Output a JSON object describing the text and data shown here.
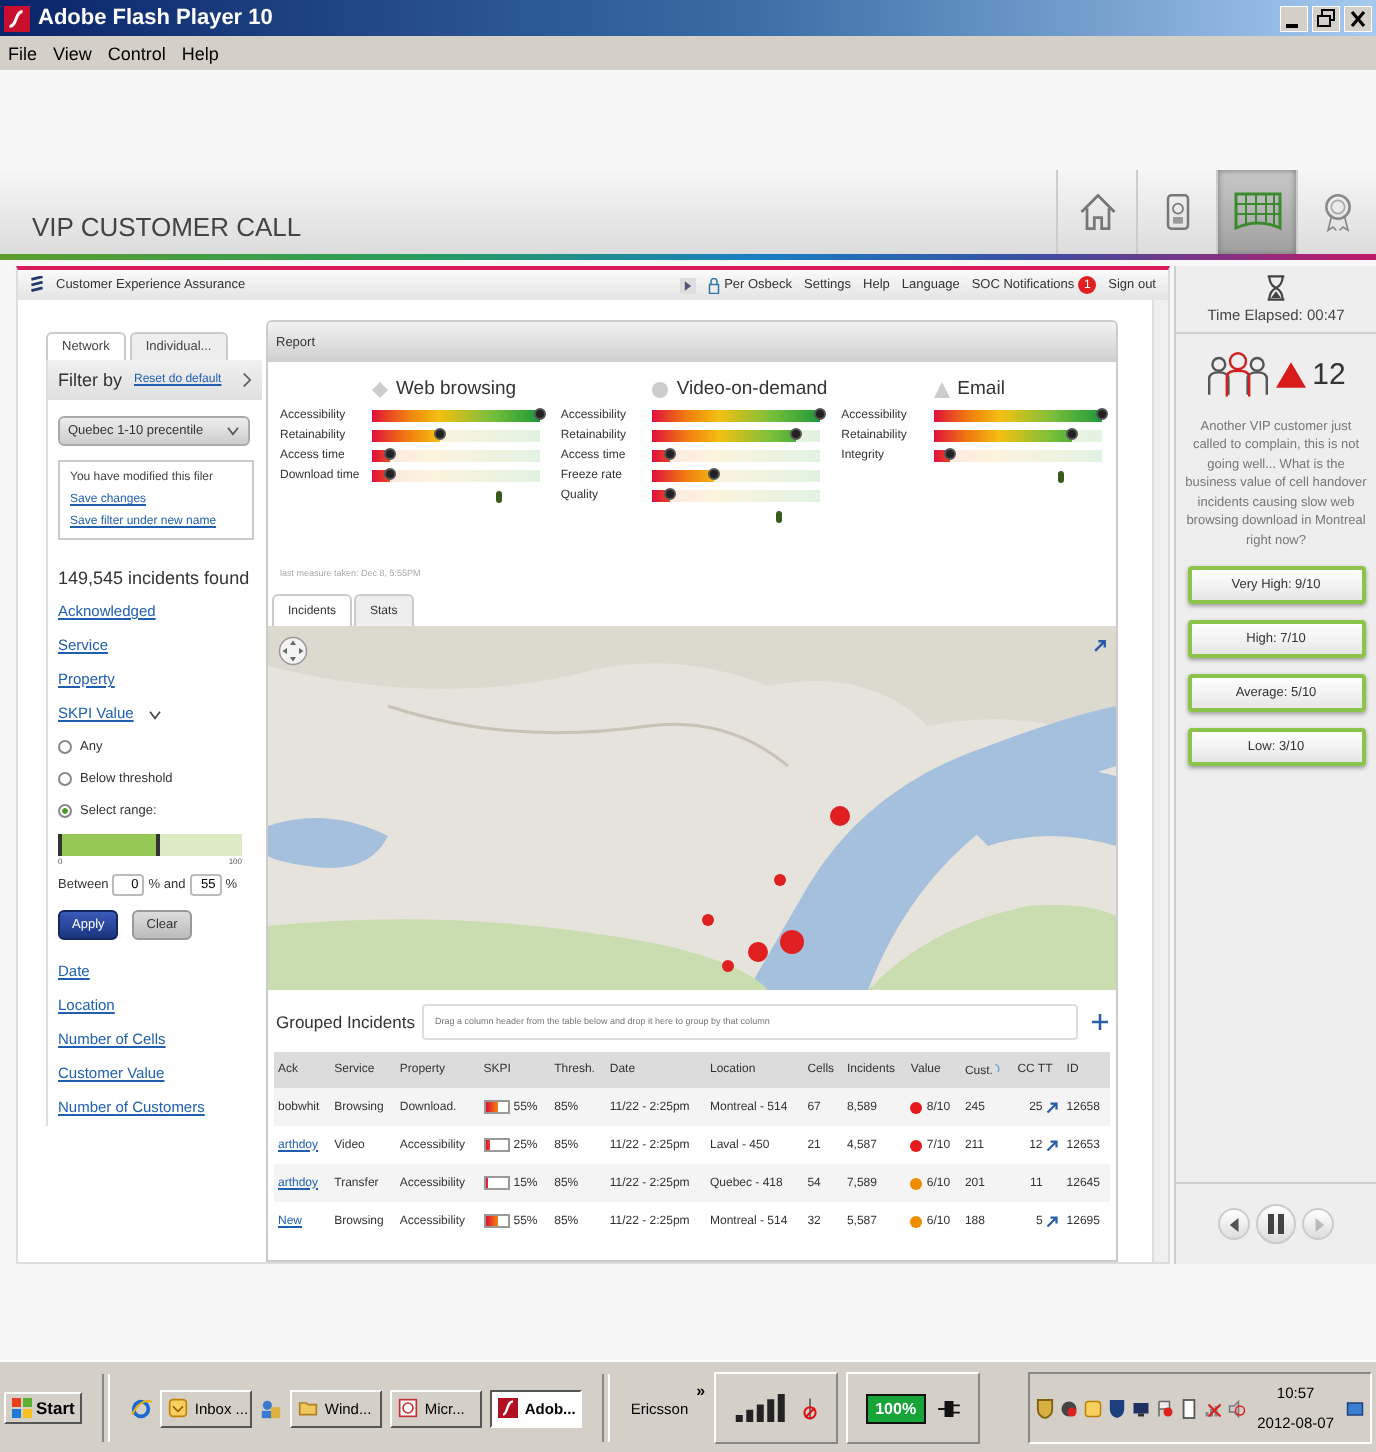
{
  "window": {
    "title": "Adobe Flash Player 10"
  },
  "menu": [
    "File",
    "View",
    "Control",
    "Help"
  ],
  "header": {
    "title": "VIP CUSTOMER CALL",
    "nav": [
      {
        "kind": "home",
        "selected": false
      },
      {
        "kind": "phone",
        "selected": false
      },
      {
        "kind": "grid",
        "selected": true
      },
      {
        "kind": "award",
        "selected": false
      }
    ]
  },
  "app_bar": {
    "title": "Customer Experience Assurance",
    "user": "Per Osbeck",
    "links": [
      "Settings",
      "Help",
      "Language"
    ],
    "notifications": {
      "label": "SOC Notifications",
      "count": "1"
    },
    "sign_out": "Sign out"
  },
  "filter": {
    "tabs": [
      {
        "label": "Network",
        "selected": true
      },
      {
        "label": "Individual...",
        "selected": false
      }
    ],
    "title": "Filter by",
    "reset": "Reset do default",
    "preset": "Quebec 1-10 precentile",
    "notice": {
      "text": "You have modified this filer",
      "links": [
        "Save changes",
        "Save filter under new name"
      ]
    },
    "count": "149,545 incidents found",
    "links_top": [
      "Acknowledged",
      "Service",
      "Property"
    ],
    "skpi": {
      "label": "SKPI Value",
      "expanded": true,
      "options": [
        {
          "label": "Any",
          "selected": false
        },
        {
          "label": "Below threshold",
          "selected": false
        },
        {
          "label": "Select range:",
          "selected": true
        }
      ],
      "range": {
        "level": 0.55,
        "min": "0",
        "max": "100",
        "from_label": "Between",
        "from": "0",
        "and_label": "% and",
        "to": "55",
        "unit": "%"
      }
    },
    "buttons": [
      {
        "label": "Apply",
        "kind": "primary"
      },
      {
        "label": "Clear",
        "kind": "secondary"
      }
    ],
    "links_bottom": [
      "Date",
      "Location",
      "Number of Cells",
      "Customer Value",
      "Number of Customers"
    ]
  },
  "report": {
    "title": "Report",
    "services": [
      {
        "name": "Web browsing",
        "kind": "diamond",
        "metrics": [
          {
            "label": "Accessibility",
            "level": 1.0
          },
          {
            "label": "Retainability",
            "level": 0.4
          },
          {
            "label": "Access time",
            "level": 0.11
          },
          {
            "label": "Download time",
            "level": 0.11
          }
        ]
      },
      {
        "name": "Video-on-demand",
        "kind": "circle",
        "metrics": [
          {
            "label": "Accessibility",
            "level": 1.0
          },
          {
            "label": "Retainability",
            "level": 0.85
          },
          {
            "label": "Access time",
            "level": 0.1
          },
          {
            "label": "Freeze rate",
            "level": 0.37
          },
          {
            "label": "Quality",
            "level": 0.1
          }
        ]
      },
      {
        "name": "Email",
        "kind": "triangle",
        "metrics": [
          {
            "label": "Accessibility",
            "level": 1.0
          },
          {
            "label": "Retainability",
            "level": 0.83
          },
          {
            "label": "Integrity",
            "level": 0.1
          }
        ]
      }
    ],
    "last_measure": "last measure taken: Dec 8, 5:55PM",
    "tabs": [
      {
        "label": "Incidents",
        "selected": true
      },
      {
        "label": "Stats",
        "selected": false
      }
    ]
  },
  "grouped": {
    "title": "Grouped Incidents",
    "drop_hint": "Drag a column header from the table below and drop it here to group by that column"
  },
  "table": {
    "columns": [
      {
        "label": "Ack",
        "sorted": false
      },
      {
        "label": "Service",
        "sorted": false
      },
      {
        "label": "Property",
        "sorted": false
      },
      {
        "label": "SKPI",
        "sorted": false
      },
      {
        "label": "Thresh.",
        "sorted": false
      },
      {
        "label": "Date",
        "sorted": false
      },
      {
        "label": "Location",
        "sorted": false
      },
      {
        "label": "Cells",
        "sorted": false
      },
      {
        "label": "Incidents",
        "sorted": false
      },
      {
        "label": "Value",
        "sorted": false
      },
      {
        "label": "Cust.",
        "sorted": true
      },
      {
        "label": "CC TT",
        "sorted": false
      },
      {
        "label": "ID",
        "sorted": false
      }
    ],
    "rows": [
      {
        "ack": "bobwhit",
        "ack_link": false,
        "service": "Browsing",
        "property": "Download.",
        "skpi": {
          "level": 0.55,
          "text": "55%"
        },
        "thresh": "85%",
        "date": "11/22 - 2:25pm",
        "location": "Montreal - 514",
        "cells": "67",
        "incidents": "8,589",
        "value": {
          "color": "#e8191a",
          "text": "8/10"
        },
        "cust": "245",
        "cctt": "25",
        "trend": true,
        "id": "12658"
      },
      {
        "ack": "arthdoy",
        "ack_link": true,
        "service": "Video",
        "property": "Accessibility",
        "skpi": {
          "level": 0.25,
          "text": "25%"
        },
        "thresh": "85%",
        "date": "11/22 - 2:25pm",
        "location": "Laval - 450",
        "cells": "21",
        "incidents": "4,587",
        "value": {
          "color": "#e8191a",
          "text": "7/10"
        },
        "cust": "211",
        "cctt": "12",
        "trend": true,
        "id": "12653"
      },
      {
        "ack": "arthdoy",
        "ack_link": true,
        "service": "Transfer",
        "property": "Accessibility",
        "skpi": {
          "level": 0.15,
          "text": "15%"
        },
        "thresh": "85%",
        "date": "11/22 - 2:25pm",
        "location": "Quebec - 418",
        "cells": "54",
        "incidents": "7,589",
        "value": {
          "color": "#f08c00",
          "text": "6/10"
        },
        "cust": "201",
        "cctt": "11",
        "trend": false,
        "id": "12645"
      },
      {
        "ack": "New",
        "ack_link": true,
        "service": "Browsing",
        "property": "Accessibility",
        "skpi": {
          "level": 0.55,
          "text": "55%"
        },
        "thresh": "85%",
        "date": "11/22 - 2:25pm",
        "location": "Montreal - 514",
        "cells": "32",
        "incidents": "5,587",
        "value": {
          "color": "#f08c00",
          "text": "6/10"
        },
        "cust": "188",
        "cctt": "5",
        "trend": true,
        "id": "12695"
      }
    ]
  },
  "call": {
    "elapsed": "Time Elapsed: 00:47",
    "alerts": "12",
    "question": "Another VIP customer just called to complain, this is not going well... What is the business value of cell handover incidents causing slow web browsing download in Montreal right now?",
    "answers": [
      "Very High: 9/10",
      "High: 7/10",
      "Average: 5/10",
      "Low: 3/10"
    ]
  },
  "taskbar": {
    "start": "Start",
    "tasks": [
      {
        "label": "Inbox ...",
        "kind": "mail",
        "selected": false
      },
      {
        "label": "Wind...",
        "kind": "folder",
        "selected": false
      },
      {
        "label": "Micr...",
        "kind": "app",
        "selected": false
      },
      {
        "label": "Adob...",
        "kind": "flash",
        "selected": true
      }
    ],
    "toolbar": "Ericsson",
    "more": "»",
    "battery": "100%",
    "time": "10:57",
    "date": "2012-08-07"
  }
}
